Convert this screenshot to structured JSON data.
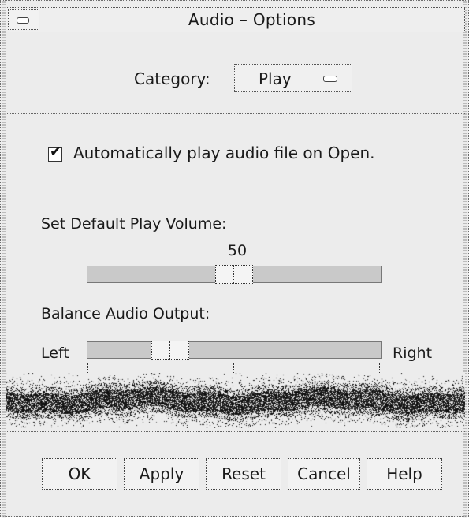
{
  "window": {
    "title": "Audio – Options",
    "menu_icon": "window-menu-icon"
  },
  "category": {
    "label": "Category:",
    "selected": "Play",
    "menu_icon": "option-menu-icon"
  },
  "auto_play": {
    "label": "Automatically play audio file on Open.",
    "checked": true
  },
  "volume": {
    "label": "Set Default Play Volume:",
    "value": "50",
    "value_fraction": 0.5
  },
  "balance": {
    "label": "Balance Audio Output:",
    "left_label": "Left",
    "right_label": "Right",
    "value_fraction": 0.25
  },
  "buttons": {
    "ok": "OK",
    "apply": "Apply",
    "reset": "Reset",
    "cancel": "Cancel",
    "help": "Help"
  }
}
